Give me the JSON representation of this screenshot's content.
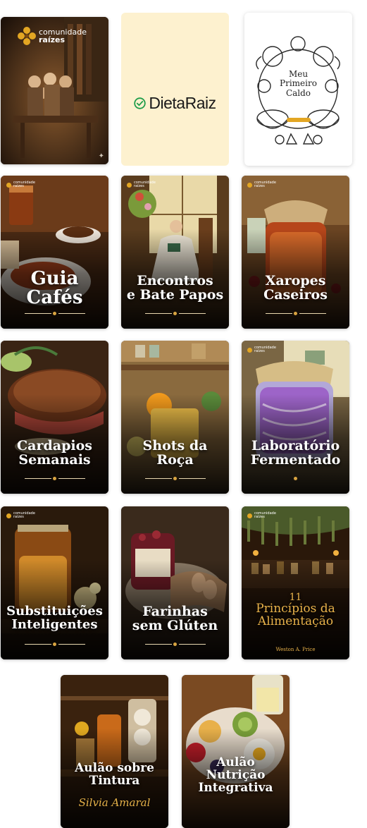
{
  "brand": {
    "logo_line1": "comunidade",
    "logo_line2": "raízes"
  },
  "dieta": {
    "name": "DietaRaiz"
  },
  "caldo": {
    "title_lines": [
      "Meu",
      "Primeiro",
      "Caldo"
    ]
  },
  "cards": [
    {
      "lines": [
        "Guia",
        "Cafés"
      ]
    },
    {
      "lines": [
        "Encontros",
        "e Bate Papos"
      ]
    },
    {
      "lines": [
        "Xaropes",
        "Caseiros"
      ]
    },
    {
      "lines": [
        "Cardapios",
        "Semanais"
      ]
    },
    {
      "lines": [
        "Shots da",
        "Roça"
      ]
    },
    {
      "lines": [
        "Laboratório",
        "Fermentado"
      ]
    },
    {
      "lines": [
        "Substituições",
        "Inteligentes"
      ]
    },
    {
      "lines": [
        "Farinhas",
        "sem Glúten"
      ]
    },
    {
      "lines": [
        "11",
        "Princípios da",
        "Alimentação"
      ],
      "author": "Weston A. Price"
    },
    {
      "lines": [
        "Aulão sobre",
        "Tintura"
      ],
      "signature": "Silvia Amaral"
    },
    {
      "lines": [
        "Aulão",
        "Nutrição",
        "Integrativa"
      ]
    }
  ],
  "colors": {
    "accent_gold": "#d9a441",
    "dieta_bg": "#fdf1cf",
    "dieta_green": "#1f9d4a"
  }
}
